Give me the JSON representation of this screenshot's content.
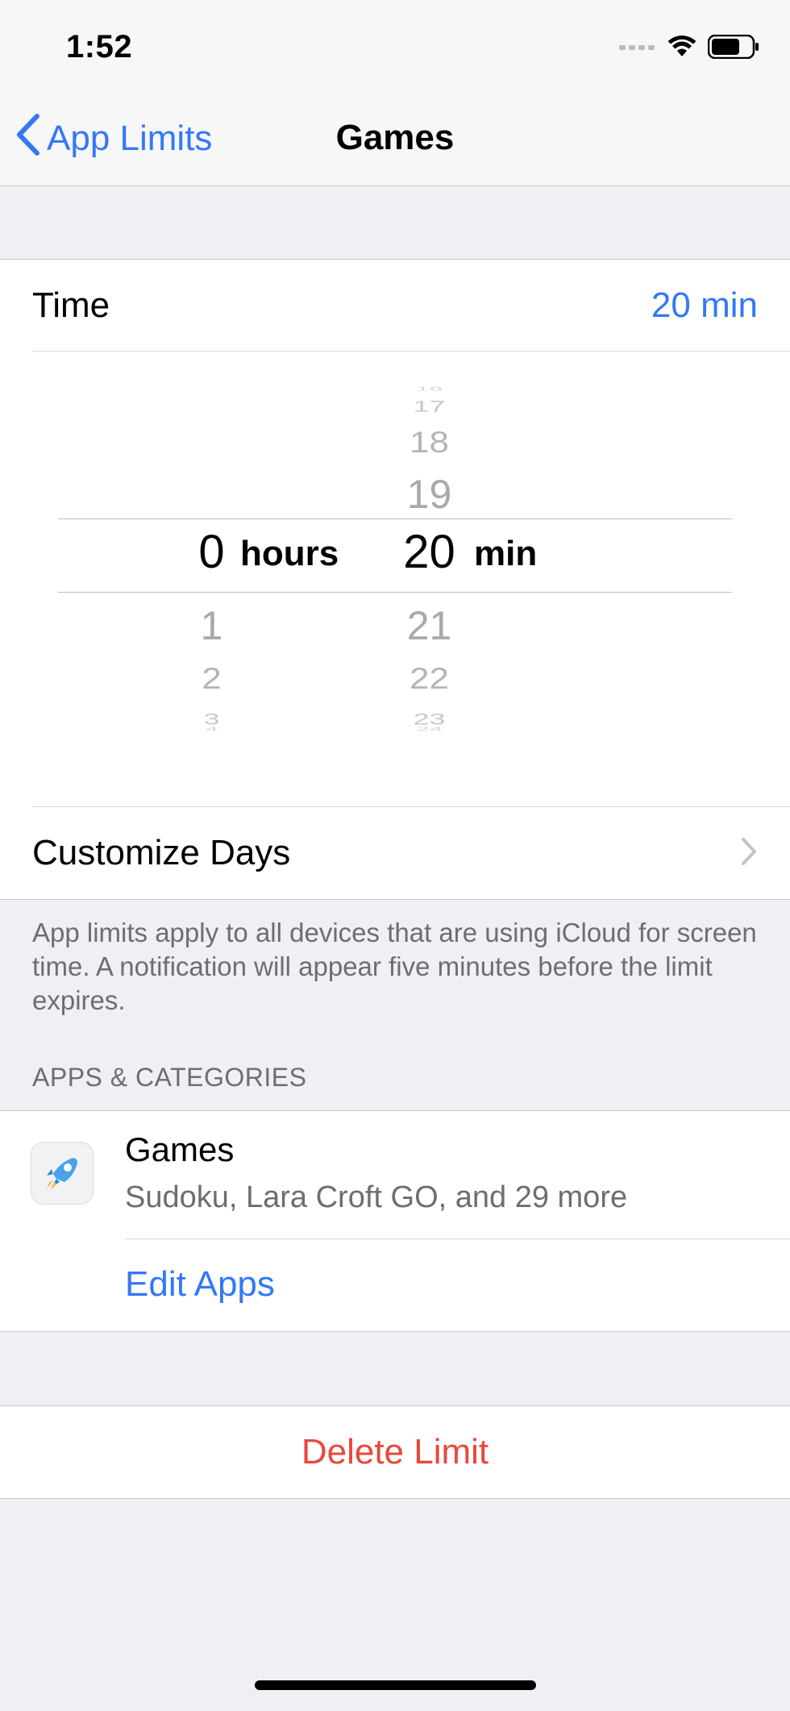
{
  "status_bar": {
    "time": "1:52",
    "icons": [
      "cellular-icon",
      "wifi-icon",
      "battery-icon"
    ]
  },
  "nav": {
    "back_label": "App Limits",
    "title": "Games"
  },
  "time_row": {
    "label": "Time",
    "value": "20 min"
  },
  "picker": {
    "hours_values_above": [],
    "hours_selected": "0",
    "hours_unit": "hours",
    "hours_values_below": [
      "1",
      "2",
      "3",
      "4"
    ],
    "minutes_values_above": [
      "16",
      "17",
      "18",
      "19"
    ],
    "minutes_selected": "20",
    "minutes_unit": "min",
    "minutes_values_below": [
      "21",
      "22",
      "23",
      "24"
    ]
  },
  "customize_days": {
    "label": "Customize Days"
  },
  "footer_note": "App limits apply to all devices that are using iCloud for screen time. A notification will appear five minutes before the limit expires.",
  "apps_section": {
    "header": "APPS & CATEGORIES",
    "item_name": "Games",
    "item_subtitle": "Sudoku, Lara Croft GO, and 29 more",
    "edit_label": "Edit Apps"
  },
  "delete": {
    "label": "Delete Limit"
  },
  "colors": {
    "accent": "#3478f6",
    "destructive": "#e8483b",
    "background": "#efeff4"
  }
}
